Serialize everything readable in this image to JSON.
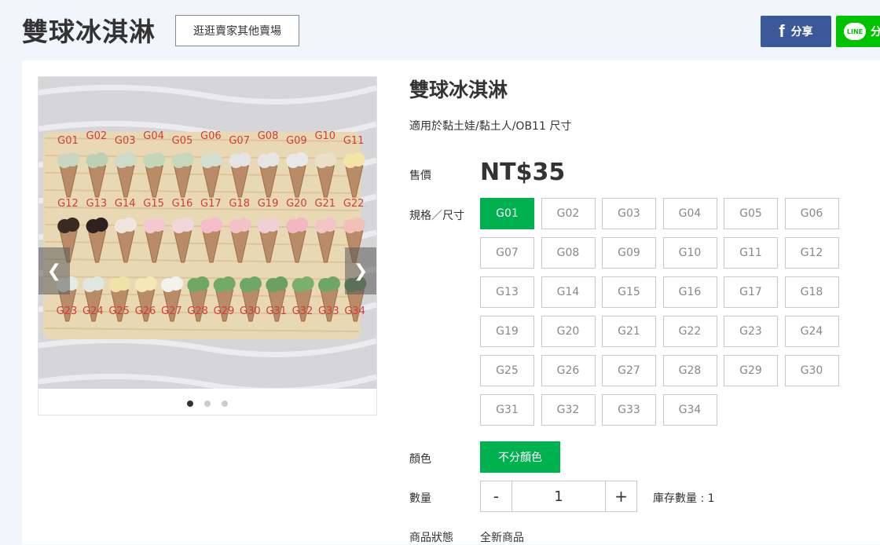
{
  "header": {
    "store_title": "雙球冰淇淋",
    "browse_label": "逛逛賣家其他賣場",
    "share_fb_label": "分享",
    "share_line_label": "分",
    "line_logo_text": "LINE",
    "fb_logo_text": "f"
  },
  "gallery": {
    "prev_icon": "chevron-left",
    "next_icon": "chevron-right",
    "dot_count": 3,
    "active_dot": 1,
    "photo_labels_row1": [
      "G01",
      "G02",
      "G03",
      "G04",
      "G05",
      "G06",
      "G07",
      "G08",
      "G09",
      "G10",
      "G11"
    ],
    "photo_labels_row2": [
      "G12",
      "G13",
      "G14",
      "G15",
      "G16",
      "G17",
      "G18",
      "G19",
      "G20",
      "G21",
      "G22"
    ],
    "photo_labels_row3": [
      "G23",
      "G24",
      "G25",
      "G26",
      "G27",
      "G28",
      "G29",
      "G30",
      "G31",
      "G32",
      "G33",
      "G34"
    ]
  },
  "product": {
    "title": "雙球冰淇淋",
    "description": "適用於黏土娃/黏土人/OB11 尺寸",
    "price_label": "售價",
    "price": "NT$35",
    "spec_label": "規格／尺寸",
    "specs": [
      "G01",
      "G02",
      "G03",
      "G04",
      "G05",
      "G06",
      "G07",
      "G08",
      "G09",
      "G10",
      "G11",
      "G12",
      "G13",
      "G14",
      "G15",
      "G16",
      "G17",
      "G18",
      "G19",
      "G20",
      "G21",
      "G22",
      "G23",
      "G24",
      "G25",
      "G26",
      "G27",
      "G28",
      "G29",
      "G30",
      "G31",
      "G32",
      "G33",
      "G34"
    ],
    "selected_spec": "G01",
    "color_label": "顏色",
    "color_option": "不分顏色",
    "qty_label": "數量",
    "qty_minus": "-",
    "qty_value": "1",
    "qty_plus": "+",
    "stock_text": "庫存數量 : 1",
    "status_label": "商品狀態",
    "status_value": "全新商品"
  },
  "colors": {
    "green": "#00b14f",
    "facebook": "#3b5998",
    "line": "#00c300"
  }
}
